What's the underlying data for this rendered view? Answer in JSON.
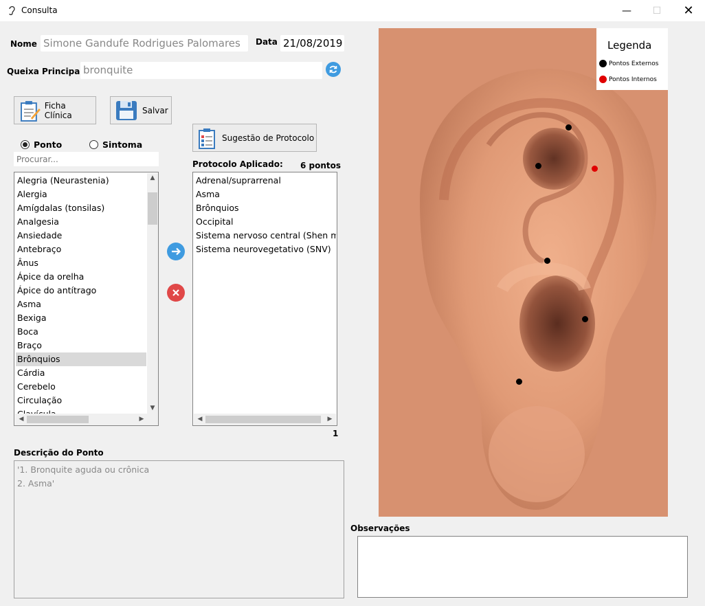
{
  "window": {
    "title": "Consulta",
    "app_icon": "ear-icon"
  },
  "form": {
    "nome_label": "Nome",
    "nome_value": "Simone Gandufe Rodrigues Palomares",
    "data_label": "Data",
    "data_value": "21/08/2019",
    "queixa_label": "Queixa Principal",
    "queixa_value": "bronquite"
  },
  "toolbar": {
    "ficha_label": "Ficha Clínica",
    "salvar_label": "Salvar",
    "sugestao_label": "Sugestão de Protocolo"
  },
  "search": {
    "mode_ponto": "Ponto",
    "mode_sintoma": "Sintoma",
    "selected_mode": "Ponto",
    "placeholder": "Procurar..."
  },
  "points_list": {
    "items": [
      "Alegria (Neurastenia)",
      "Alergia",
      "Amígdalas (tonsilas)",
      "Analgesia",
      "Ansiedade",
      "Antebraço",
      "Ânus",
      "Ápice da orelha",
      "Ápice do antítrago",
      "Asma",
      "Bexiga",
      "Boca",
      "Braço",
      "Brônquios",
      "Cárdia",
      "Cerebelo",
      "Circulação",
      "Clavícula"
    ],
    "selected": "Brônquios"
  },
  "protocol": {
    "label": "Protocolo Aplicado:",
    "count_label": "6 pontos",
    "items": [
      "Adrenal/suprarrenal",
      "Asma",
      "Brônquios",
      "Occipital",
      "Sistema nervoso central (Shen men)",
      "Sistema neurovegetativo (SNV)"
    ],
    "page": "1"
  },
  "description": {
    "label": "Descrição do Ponto",
    "lines": [
      "'1. Bronquite aguda ou crônica",
      "2. Asma'"
    ]
  },
  "observacoes": {
    "label": "Observações",
    "value": ""
  },
  "legend": {
    "title": "Legenda",
    "external": "Pontos Externos",
    "internal": "Pontos Internos",
    "external_color": "#000000",
    "internal_color": "#e00000"
  },
  "colors": {
    "accent_blue": "#3f9be0",
    "remove_red": "#e04848"
  }
}
